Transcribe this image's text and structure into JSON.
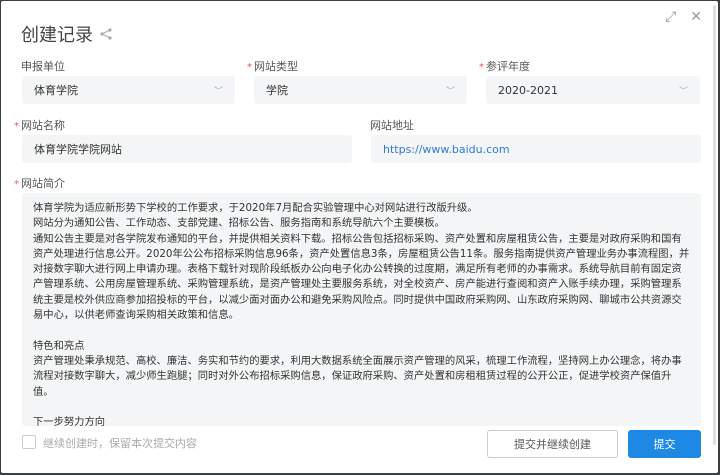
{
  "dialog": {
    "title": "创建记录",
    "share_icon": "share-icon",
    "expand_icon": "expand-icon",
    "close_icon": "close-icon"
  },
  "fields": {
    "unit": {
      "label": "申报单位",
      "value": "体育学院",
      "required": false
    },
    "site_type": {
      "label": "网站类型",
      "value": "学院",
      "required": true
    },
    "year": {
      "label": "参评年度",
      "value": "2020-2021",
      "required": true
    },
    "site_name": {
      "label": "网站名称",
      "value": "体育学院学院网站",
      "required": true
    },
    "site_url": {
      "label": "网站地址",
      "value": "https://www.baidu.com",
      "required": false
    },
    "intro": {
      "label": "网站简介",
      "required": true,
      "lines": [
        "体育学院为适应新形势下学校的工作要求，于2020年7月配合实验管理中心对网站进行改版升级。",
        "网站分为通知公告、工作动态、支部党建、招标公告、服务指南和系统导航六个主要模板。",
        "通知公告主要是对各学院发布通知的平台，并提供相关资料下载。招标公告包括招标采购、资产处置和房屋租赁公告，主要是对政府采购和国有",
        "资产处理进行信息公开。2020年公公布招标采购信息96条，资产处置信息3条，房屋租赁公告11条。服务指南提供资产管理业务办事流程图，并",
        "对接数字聊大进行网上申请办理。表格下载针对现阶段纸板办公向电子化办公转换的过度期，满足所有老师的办事需求。系统导航目前有固定资",
        "产管理系统、公用房屋管理系统、采购管理系统，是资产管理处主要服务系统，对全校资产、房产能进行查阅和资产入账手续办理，采购管理系",
        "统主要是校外供应商参加招投标的平台，以减少面对面办公和避免采购风险点。同时提供中国政府采购网、山东政府采购网、聊城市公共资源交",
        "易中心，以供老师查询采购相关政策和信息。",
        "",
        "特色和亮点",
        "资产管理处秉承规范、高校、廉洁、务实和节约的要求，利用大数据系统全面展示资产管理的风采，梳理工作流程，坚持网上办公理念，将办事",
        "流程对接数字聊大，减少师生跑腿；同时对外公布招标采购信息，保证政府采购、资产处置和房租租赁过程的公开公正，促进学校资产保值升",
        "值。",
        "",
        "下一步努力方向"
      ]
    }
  },
  "footer": {
    "keep_label": "继续创建时，保留本次提交内容",
    "keep_checked": false,
    "submit_continue": "提交并继续创建",
    "submit": "提交"
  }
}
